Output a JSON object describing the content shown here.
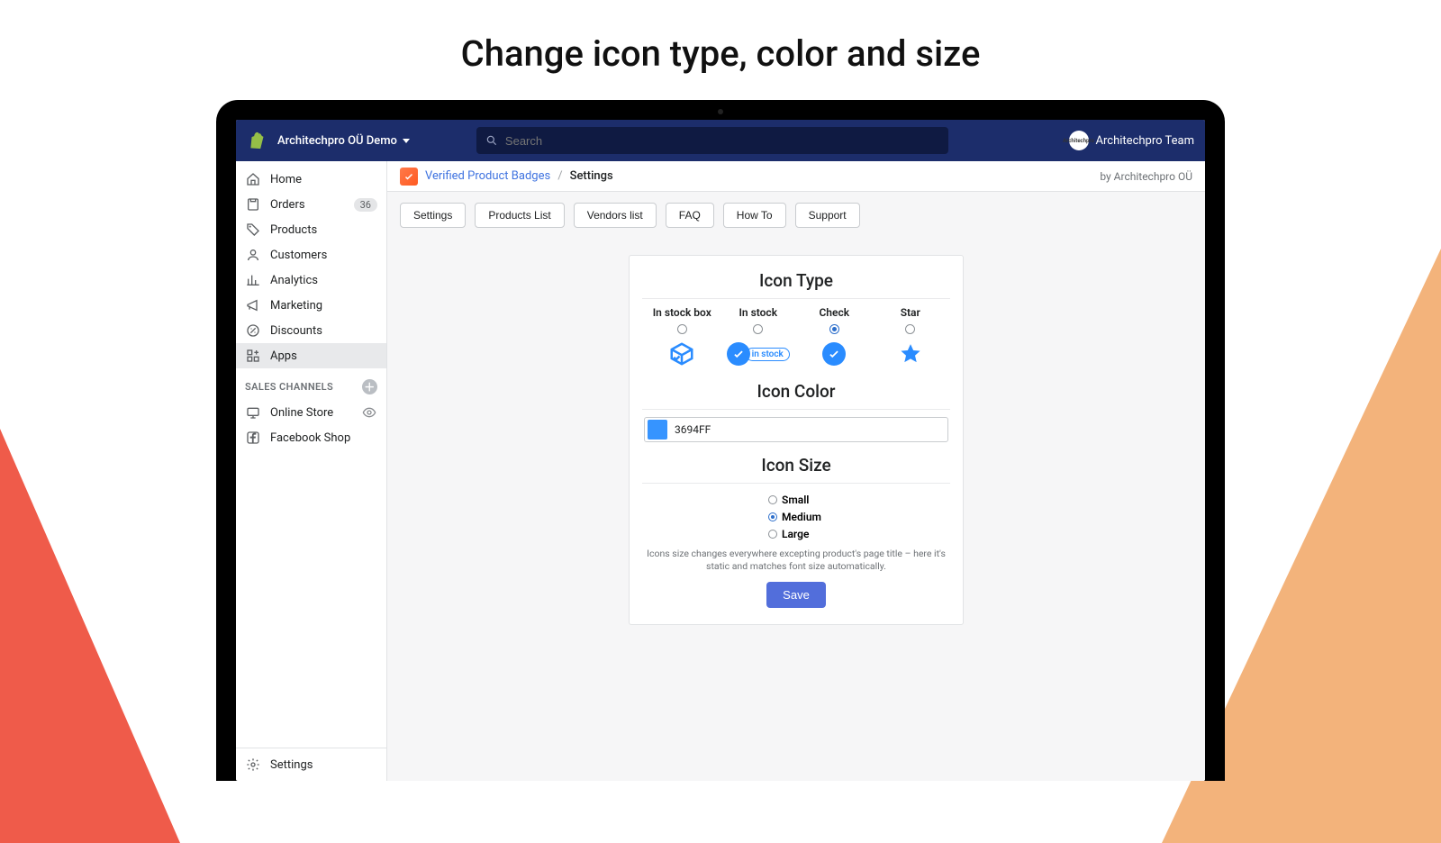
{
  "headline": "Change icon type, color and size",
  "topbar": {
    "store_name": "Architechpro OÜ Demo",
    "search_placeholder": "Search",
    "user_name": "Architechpro Team",
    "avatar_text": "Architechpro"
  },
  "sidebar": {
    "items": [
      {
        "label": "Home"
      },
      {
        "label": "Orders",
        "badge": "36"
      },
      {
        "label": "Products"
      },
      {
        "label": "Customers"
      },
      {
        "label": "Analytics"
      },
      {
        "label": "Marketing"
      },
      {
        "label": "Discounts"
      },
      {
        "label": "Apps",
        "active": true
      }
    ],
    "channels_header": "SALES CHANNELS",
    "channels": [
      {
        "label": "Online Store"
      },
      {
        "label": "Facebook Shop"
      }
    ],
    "footer_label": "Settings"
  },
  "breadcrumb": {
    "app": "Verified Product Badges",
    "current": "Settings",
    "byline": "by Architechpro OÜ"
  },
  "tabs": [
    "Settings",
    "Products List",
    "Vendors list",
    "FAQ",
    "How To",
    "Support"
  ],
  "icon_type": {
    "heading": "Icon Type",
    "options": [
      "In stock box",
      "In stock",
      "Check",
      "Star"
    ],
    "selected_index": 2,
    "instock_pill_text": "in stock"
  },
  "icon_color": {
    "heading": "Icon Color",
    "hex": "3694FF",
    "swatch": "#3694FF"
  },
  "icon_size": {
    "heading": "Icon Size",
    "options": [
      "Small",
      "Medium",
      "Large"
    ],
    "selected_index": 1,
    "hint": "Icons size changes everywhere excepting product's page title – here it's static and matches font size automatically."
  },
  "save_label": "Save"
}
